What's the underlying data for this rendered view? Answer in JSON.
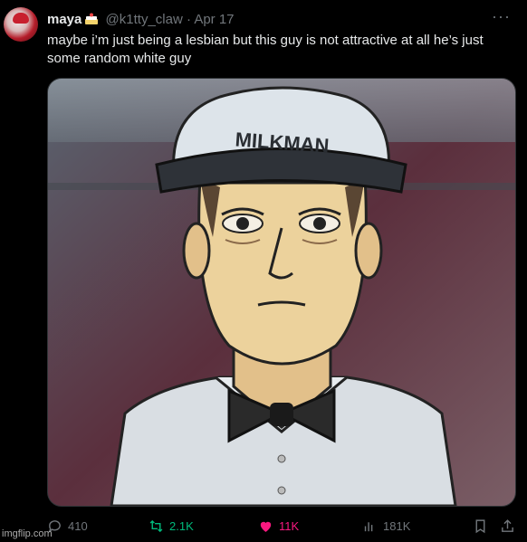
{
  "tweet": {
    "author": {
      "display_name": "maya",
      "handle": "@k1tty_claw",
      "separator": "·",
      "date": "Apr 17",
      "name_emoji": "cake-icon"
    },
    "text": "maybe i’m just being a lesbian but this guy is not attractive at all he’s just some random white guy",
    "media": {
      "hat_text": "MILKMAN"
    },
    "more_icon": "more-icon"
  },
  "actions": {
    "reply_count": "410",
    "retweet_count": "2.1K",
    "like_count": "11K",
    "view_count": "181K",
    "retweet_color": "#00ba7c",
    "like_color": "#f91880"
  },
  "watermark": "imgflip.com"
}
